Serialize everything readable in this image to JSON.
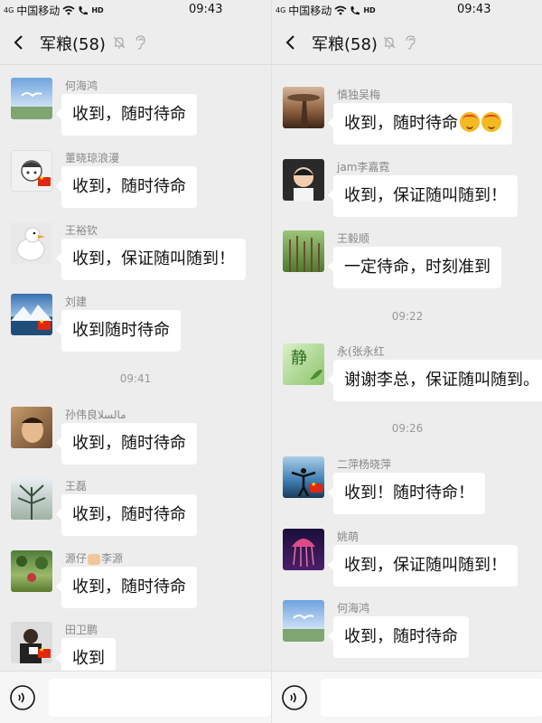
{
  "status_bar": {
    "signal": "4G",
    "carrier": "中国移动",
    "hd": "HD",
    "time": "09:43"
  },
  "colors": {
    "bubble": "#ffffff",
    "chat_background": "#ededed",
    "timestamp": "#999999",
    "sender_name": "#888888",
    "flag_red": "#de2910",
    "flag_star": "#ffde00"
  },
  "left": {
    "title": "军粮(58)",
    "messages": [
      {
        "sender": "何海鸿",
        "text": "收到，随时待命",
        "avatar": "birds-sky-avatar"
      },
      {
        "sender": "董晓琼浪漫",
        "text": "收到，随时待命",
        "avatar": "cartoon-avatar"
      },
      {
        "sender": "王裕钦",
        "text": "收到，保证随叫随到！",
        "avatar": "duck-avatar"
      },
      {
        "sender": "刘建",
        "text": "收到随时待命",
        "avatar": "mountain-avatar"
      },
      {
        "sender": "孙伟良مالسلا",
        "text": "收到，随时待命",
        "avatar": "portrait-avatar"
      },
      {
        "sender": "王磊",
        "text": "收到，随时待命",
        "avatar": "tree-avatar"
      },
      {
        "sender_pre": "源仔",
        "sender_post": "李源",
        "text": "收到，随时待命",
        "avatar": "garden-avatar"
      },
      {
        "sender": "田卫鹏",
        "text": "收到",
        "avatar": "person-avatar"
      }
    ],
    "timestamp": "09:41"
  },
  "right": {
    "title": "军粮(58)",
    "messages": [
      {
        "sender": "慎独吴梅",
        "text": "收到，随时待命",
        "avatar": "rock-sunset-avatar",
        "emoji": "angry-face-emoji"
      },
      {
        "sender": "jam李嘉霓",
        "text": "收到，保证随叫随到！",
        "avatar": "child-avatar"
      },
      {
        "sender": "王毅顺",
        "text": "一定待命，时刻准到",
        "avatar": "forest-avatar"
      },
      {
        "sender": "永(张永红",
        "text": "谢谢李总，保证随叫随到。",
        "avatar": "calligraphy-avatar",
        "avatar_text": "静"
      },
      {
        "sender": "二萍杨晓萍",
        "text": "收到！随时待命！",
        "avatar": "beach-avatar"
      },
      {
        "sender": "姚萌",
        "text": "收到，保证随叫随到！",
        "avatar": "jellyfish-avatar"
      },
      {
        "sender": "何海鸿",
        "text": "收到，随时待命",
        "avatar": "birds-sky-avatar"
      }
    ],
    "timestamps": [
      "09:22",
      "09:26"
    ]
  }
}
